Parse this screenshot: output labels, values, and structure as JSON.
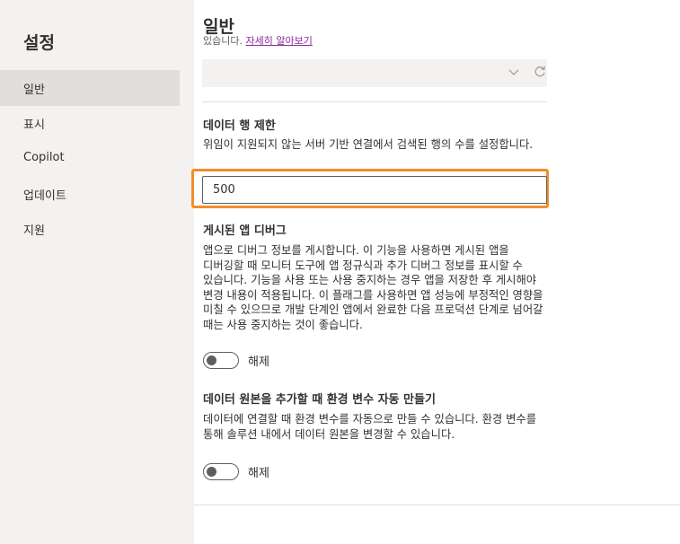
{
  "sidebar": {
    "title": "설정",
    "items": [
      {
        "label": "일반"
      },
      {
        "label": "표시"
      },
      {
        "label": "Copilot"
      },
      {
        "label": "업데이트"
      },
      {
        "label": "지원"
      }
    ]
  },
  "main": {
    "title": "일반",
    "clipped_text": "있습니다.",
    "learn_more": "자세히 알아보기",
    "row_limit": {
      "title": "데이터 행 제한",
      "description": "위임이 지원되지 않는 서버 기반 연결에서 검색된 행의 수를 설정합니다.",
      "value": "500"
    },
    "debug": {
      "title": "게시된 앱 디버그",
      "description": "앱으로 디버그 정보를 게시합니다. 이 기능을 사용하면 게시된 앱을 디버깅할 때 모니터 도구에 앱 정규식과 추가 디버그 정보를 표시할 수 있습니다. 기능을 사용 또는 사용 중지하는 경우 앱을 저장한 후 게시해야 변경 내용이 적용됩니다. 이 플래그를 사용하면 앱 성능에 부정적인 영향을 미칠 수 있으므로 개발 단계인 앱에서 완료한 다음 프로덕션 단계로 넘어갈 때는 사용 중지하는 것이 좋습니다.",
      "toggle_label": "해제"
    },
    "env_vars": {
      "title": "데이터 원본을 추가할 때 환경 변수 자동 만들기",
      "description": "데이터에 연결할 때 환경 변수를 자동으로 만들 수 있습니다. 환경 변수를 통해 솔루션 내에서 데이터 원본을 변경할 수 있습니다.",
      "toggle_label": "해제"
    }
  },
  "colors": {
    "highlight": "#f18e2b",
    "sidebar_bg": "#f3f2f1",
    "selected_bg": "#e1dfdd",
    "link": "#8a2b9b"
  }
}
